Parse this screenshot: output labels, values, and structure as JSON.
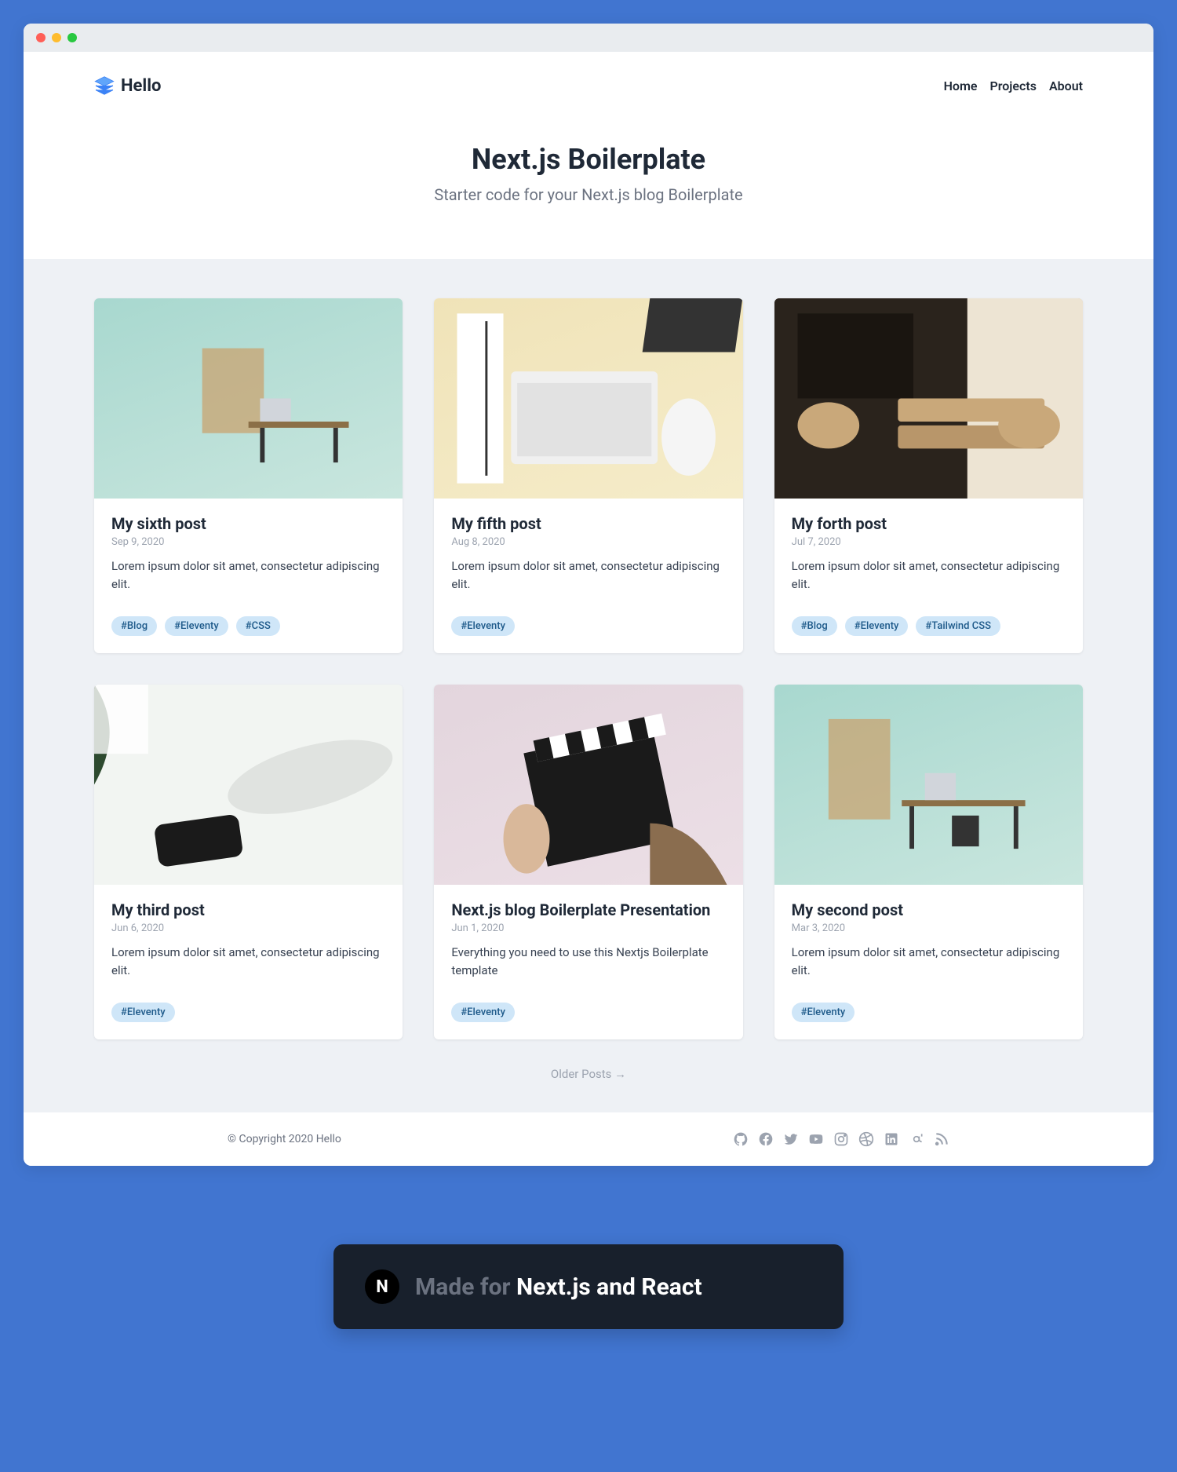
{
  "brand": "Hello",
  "nav": {
    "home": "Home",
    "projects": "Projects",
    "about": "About"
  },
  "hero": {
    "title": "Next.js Boilerplate",
    "subtitle": "Starter code for your Next.js blog Boilerplate"
  },
  "posts": [
    {
      "title": "My sixth post",
      "date": "Sep 9, 2020",
      "excerpt": "Lorem ipsum dolor sit amet, consectetur adipiscing elit.",
      "tags": [
        "#Blog",
        "#Eleventy",
        "#CSS"
      ]
    },
    {
      "title": "My fifth post",
      "date": "Aug 8, 2020",
      "excerpt": "Lorem ipsum dolor sit amet, consectetur adipiscing elit.",
      "tags": [
        "#Eleventy"
      ]
    },
    {
      "title": "My forth post",
      "date": "Jul 7, 2020",
      "excerpt": "Lorem ipsum dolor sit amet, consectetur adipiscing elit.",
      "tags": [
        "#Blog",
        "#Eleventy",
        "#Tailwind CSS"
      ]
    },
    {
      "title": "My third post",
      "date": "Jun 6, 2020",
      "excerpt": "Lorem ipsum dolor sit amet, consectetur adipiscing elit.",
      "tags": [
        "#Eleventy"
      ]
    },
    {
      "title": "Next.js blog Boilerplate Presentation",
      "date": "Jun 1, 2020",
      "excerpt": "Everything you need to use this Nextjs Boilerplate template",
      "tags": [
        "#Eleventy"
      ]
    },
    {
      "title": "My second post",
      "date": "Mar 3, 2020",
      "excerpt": "Lorem ipsum dolor sit amet, consectetur adipiscing elit.",
      "tags": [
        "#Eleventy"
      ]
    }
  ],
  "olderPosts": "Older Posts →",
  "footer": {
    "copyright": "© Copyright 2020 Hello"
  },
  "badge": {
    "prefix": "Made for ",
    "suffix": "Next.js and React",
    "logo": "N"
  },
  "socialIcons": [
    "github-icon",
    "facebook-icon",
    "twitter-icon",
    "youtube-icon",
    "instagram-icon",
    "dribbble-icon",
    "linkedin-icon",
    "mastodon-icon",
    "rss-icon"
  ]
}
